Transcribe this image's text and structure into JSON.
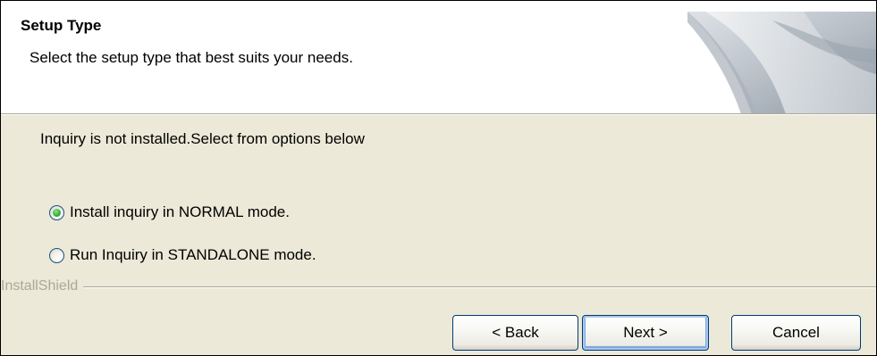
{
  "header": {
    "title": "Setup Type",
    "subtitle": "Select the setup type that best suits your needs."
  },
  "body": {
    "status_text": "Inquiry is not installed.Select from options below",
    "options": [
      {
        "label": "Install inquiry in NORMAL mode.",
        "selected": true
      },
      {
        "label": "Run Inquiry in STANDALONE mode.",
        "selected": false
      }
    ]
  },
  "branding": {
    "text": "InstallShield"
  },
  "buttons": {
    "back": "< Back",
    "next": "Next >",
    "cancel": "Cancel"
  },
  "colors": {
    "dialog_background": "#ece9d8",
    "header_background": "#ffffff",
    "radio_selected_dot": "#36b236",
    "button_border": "#003c74"
  }
}
